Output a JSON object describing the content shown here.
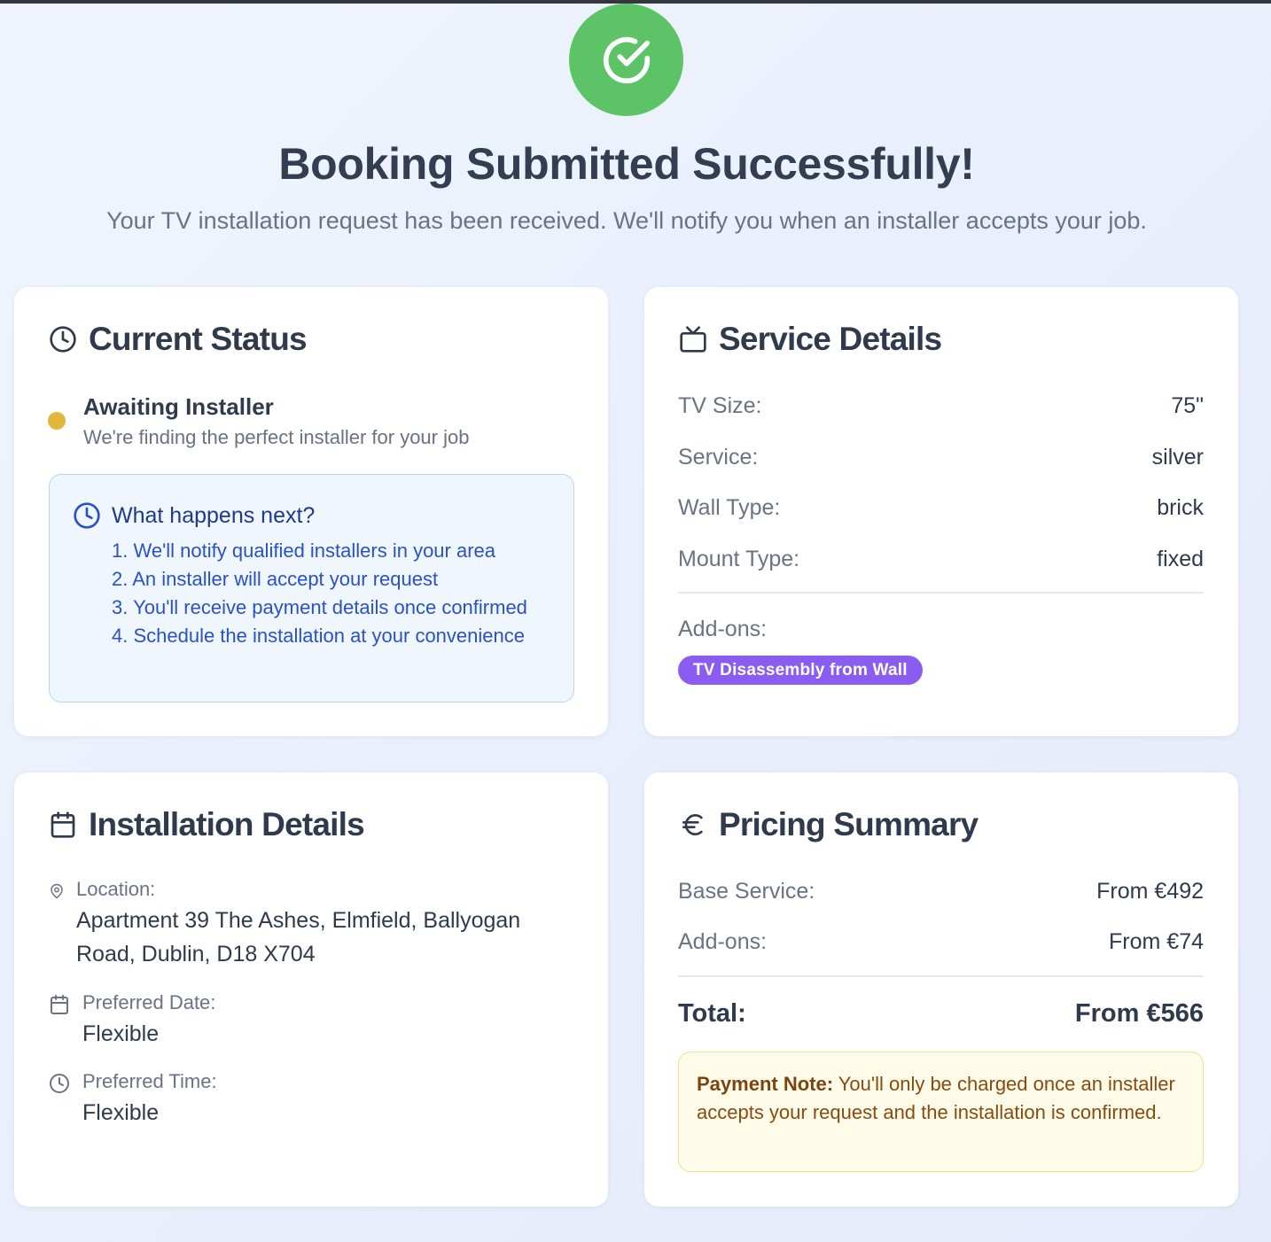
{
  "hero": {
    "title": "Booking Submitted Successfully!",
    "subtitle": "Your TV installation request has been received. We'll notify you when an installer accepts your job."
  },
  "status": {
    "title": "Current Status",
    "state": "Awaiting Installer",
    "description": "We're finding the perfect installer for your job",
    "next_title": "What happens next?",
    "next_steps": [
      "1. We'll notify qualified installers in your area",
      "2. An installer will accept your request",
      "3. You'll receive payment details once confirmed",
      "4. Schedule the installation at your convenience"
    ]
  },
  "service": {
    "title": "Service Details",
    "rows": [
      {
        "label": "TV Size:",
        "value": "75\""
      },
      {
        "label": "Service:",
        "value": "silver"
      },
      {
        "label": "Wall Type:",
        "value": "brick"
      },
      {
        "label": "Mount Type:",
        "value": "fixed"
      }
    ],
    "addons_label": "Add-ons:",
    "addons": [
      "TV Disassembly from Wall"
    ]
  },
  "installation": {
    "title": "Installation Details",
    "location_label": "Location:",
    "location_value": "Apartment 39 The Ashes, Elmfield, Ballyogan Road, Dublin, D18 X704",
    "date_label": "Preferred Date:",
    "date_value": "Flexible",
    "time_label": "Preferred Time:",
    "time_value": "Flexible"
  },
  "pricing": {
    "title": "Pricing Summary",
    "base_label": "Base Service:",
    "base_value": "From €492",
    "addons_label": "Add-ons:",
    "addons_value": "From €74",
    "total_label": "Total:",
    "total_value": "From €566",
    "note_label": "Payment Note:",
    "note_text": " You'll only be charged once an installer accepts your request and the installation is confirmed."
  },
  "colors": {
    "success": "#5cc466",
    "pending": "#e2b53c",
    "addon_badge": "#8b5cf0",
    "info_text": "#2a51c9"
  },
  "icons": {
    "hero": "check-circle-icon",
    "status": "clock-icon",
    "service": "tv-icon",
    "installation": "calendar-icon",
    "pricing": "euro-icon"
  }
}
